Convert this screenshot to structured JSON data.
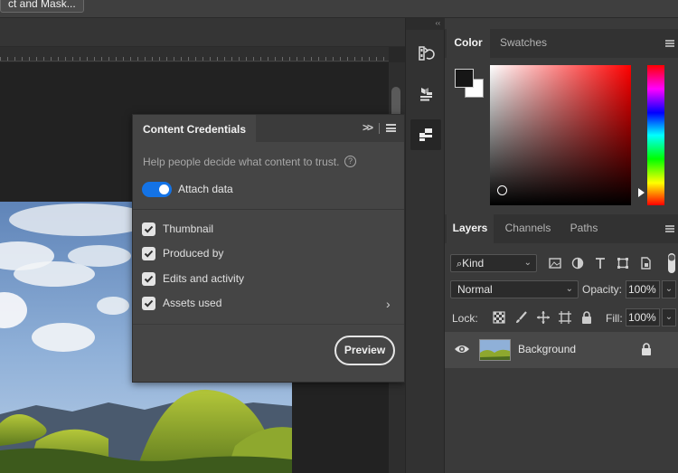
{
  "toolbar": {
    "select_mask_label": "ct and Mask..."
  },
  "content_credentials": {
    "tab_title": "Content Credentials",
    "collapse_glyph": ">>",
    "help_text": "Help people decide what content to trust.",
    "help_icon_glyph": "?",
    "attach_toggle": {
      "label": "Attach data",
      "on": true
    },
    "options": [
      {
        "label": "Thumbnail",
        "checked": true
      },
      {
        "label": "Produced by",
        "checked": true
      },
      {
        "label": "Edits and activity",
        "checked": true
      },
      {
        "label": "Assets used",
        "checked": true,
        "has_submenu": true
      }
    ],
    "submenu_glyph": "›",
    "preview_button": "Preview"
  },
  "tool_strip": {
    "collapse_glyph": "‹‹",
    "buttons": [
      "history-icon",
      "properties-icon",
      "content-credentials-icon"
    ]
  },
  "color_panel": {
    "tabs": [
      "Color",
      "Swatches"
    ],
    "active_tab": "Color",
    "foreground": "#161616",
    "background": "#ffffff",
    "hue": "#ff0000"
  },
  "layers_panel": {
    "tabs": [
      "Layers",
      "Channels",
      "Paths"
    ],
    "active_tab": "Layers",
    "filter_kind": "Kind",
    "filter_icons": [
      "image-filter-icon",
      "adjustment-filter-icon",
      "type-filter-icon",
      "shape-filter-icon",
      "smart-object-filter-icon"
    ],
    "blend_mode": "Normal",
    "opacity_label": "Opacity:",
    "opacity": "100%",
    "lock_label": "Lock:",
    "lock_icons": [
      "lock-transparent-icon",
      "lock-image-icon",
      "lock-position-icon",
      "lock-artboard-icon",
      "lock-all-icon"
    ],
    "fill_label": "Fill:",
    "fill": "100%",
    "dropdown_glyph": "⌄",
    "layers": [
      {
        "name": "Background",
        "visible": true,
        "locked": true
      }
    ]
  },
  "colors": {
    "accent": "#1473e6",
    "panel": "#454545",
    "app_bg": "#3a3a3a"
  }
}
